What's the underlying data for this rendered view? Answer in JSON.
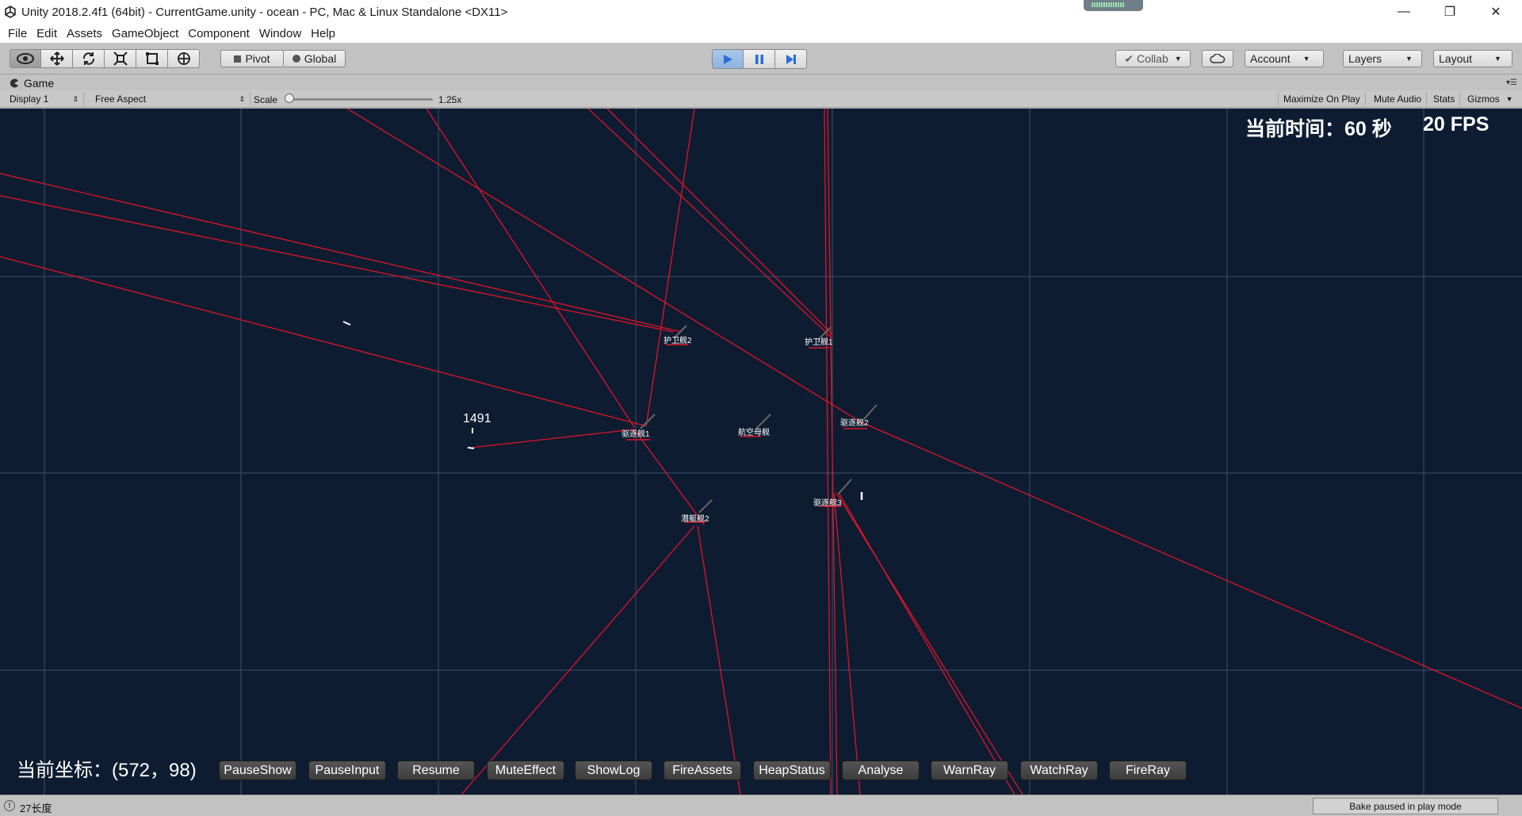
{
  "window": {
    "title": "Unity 2018.2.4f1 (64bit) - CurrentGame.unity - ocean - PC, Mac & Linux Standalone <DX11>",
    "minimize_glyph": "—",
    "maximize_glyph": "❐",
    "close_glyph": "✕"
  },
  "menu": [
    "File",
    "Edit",
    "Assets",
    "GameObject",
    "Component",
    "Window",
    "Help"
  ],
  "toolbar": {
    "tools": [
      "view-icon",
      "move-icon",
      "rotate-icon",
      "scale-icon",
      "rect-icon",
      "transform-icon"
    ],
    "pivot_label": "Pivot",
    "global_label": "Global",
    "collab_label": "Collab",
    "account_label": "Account",
    "layers_label": "Layers",
    "layout_label": "Layout"
  },
  "game_panel": {
    "tab_label": "Game",
    "display_label": "Display 1",
    "aspect_label": "Free Aspect",
    "scale_label": "Scale",
    "scale_value": "1.25x",
    "maximize_label": "Maximize On Play",
    "mute_label": "Mute Audio",
    "stats_label": "Stats",
    "gizmos_label": "Gizmos"
  },
  "hud": {
    "time_text": "当前时间：60 秒",
    "fps_text": "20 FPS",
    "coord_text": "当前坐标：(572，98)",
    "counter_text": "1491"
  },
  "units": [
    {
      "label": "护卫舰2"
    },
    {
      "label": "护卫舰1"
    },
    {
      "label": "驱逐舰1"
    },
    {
      "label": "航空母舰"
    },
    {
      "label": "驱逐舰2"
    },
    {
      "label": "驱逐舰3"
    },
    {
      "label": "潜艇舰2"
    }
  ],
  "debug_buttons": [
    "PauseShow",
    "PauseInput",
    "Resume",
    "MuteEffect",
    "ShowLog",
    "FireAssets",
    "HeapStatus",
    "Analyse",
    "WarnRay",
    "WatchRay",
    "FireRay"
  ],
  "status": {
    "message": "27长度",
    "bake_label": "Bake paused in play mode"
  },
  "colors": {
    "viewport_bg": "#0e1c31",
    "grid": "#3b4f6b",
    "ray": "#e0142a",
    "play_active": "#8fb3de"
  }
}
